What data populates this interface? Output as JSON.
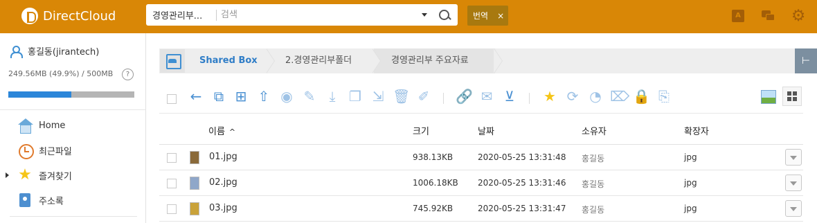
{
  "app": {
    "brand": "DirectCloud",
    "colors": {
      "header": "#d98706",
      "accent": "#2b86d9",
      "breadcrumb_link": "#2f7dc7"
    }
  },
  "header": {
    "search_scope": "경영관리부...",
    "search_placeholder": "검색",
    "translate_label": "번역",
    "translate_close": "×",
    "icons": [
      "office-icon",
      "chat-icon",
      "gear-icon"
    ]
  },
  "sidebar": {
    "user_name": "홍길동(jirantech)",
    "storage_text": "249.56MB (49.9%) / 500MB",
    "storage_used_percent": 49.9,
    "help_label": "?",
    "items": [
      {
        "label": "Home",
        "icon": "home-icon"
      },
      {
        "label": "최근파일",
        "icon": "clock-icon"
      },
      {
        "label": "즐겨찾기",
        "icon": "star-icon",
        "expandable": true
      },
      {
        "label": "주소록",
        "icon": "address-book-icon"
      }
    ]
  },
  "breadcrumb": {
    "items": [
      "Shared Box",
      "2.경영관리부폴더",
      "경영관리부 주요자료"
    ],
    "panel_toggle": "⊢"
  },
  "toolbar": {
    "icons": [
      "back-icon",
      "copy-icon",
      "new-folder-icon",
      "upload-icon",
      "preview-icon",
      "edit-icon",
      "download-icon",
      "duplicate-icon",
      "move-icon",
      "delete-icon",
      "rename-icon",
      "link-icon",
      "mail-icon",
      "download-box-icon",
      "star-icon",
      "sync-icon",
      "history-icon",
      "tag-icon",
      "lock-icon",
      "version-icon"
    ]
  },
  "table": {
    "columns": {
      "name": "이름",
      "sort_indicator": "^",
      "size": "크기",
      "date": "날짜",
      "owner": "소유자",
      "ext": "확장자"
    },
    "rows": [
      {
        "name": "01.jpg",
        "size": "938.13KB",
        "date": "2020-05-25 13:31:48",
        "owner": "홍길동",
        "ext": "jpg",
        "thumb_color": "#8a6a3a"
      },
      {
        "name": "02.jpg",
        "size": "1006.18KB",
        "date": "2020-05-25 13:31:46",
        "owner": "홍길동",
        "ext": "jpg",
        "thumb_color": "#8fa7c9"
      },
      {
        "name": "03.jpg",
        "size": "745.92KB",
        "date": "2020-05-25 13:31:47",
        "owner": "홍길동",
        "ext": "jpg",
        "thumb_color": "#c9a23a"
      }
    ]
  }
}
